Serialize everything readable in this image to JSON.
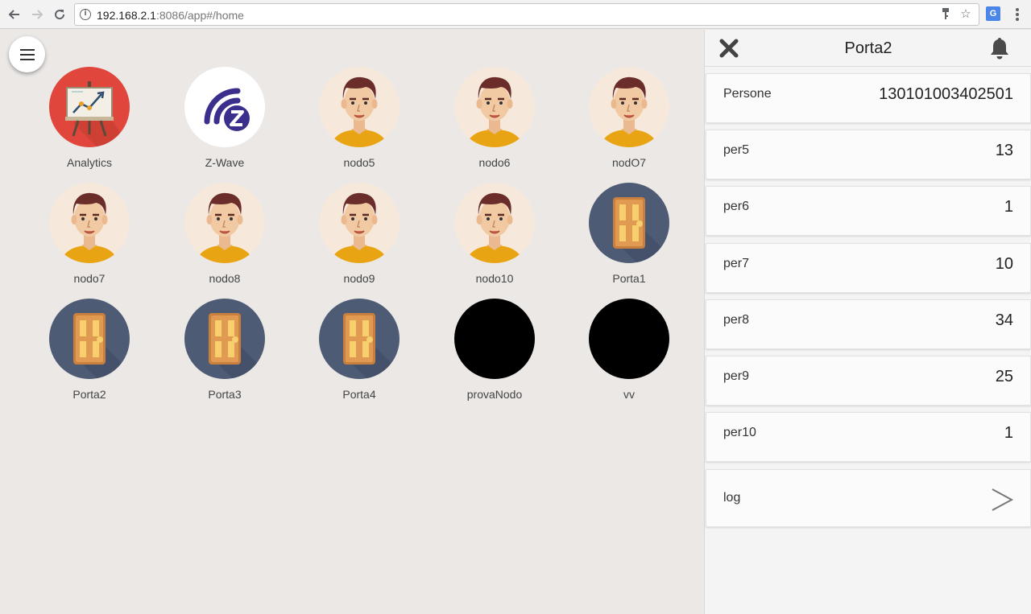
{
  "browser": {
    "url_host": "192.168.2.1",
    "url_rest": ":8086/app#/home"
  },
  "grid": {
    "tiles": [
      {
        "label": "Analytics",
        "icon": "analytics-icon"
      },
      {
        "label": "Z-Wave",
        "icon": "zwave-icon"
      },
      {
        "label": "nodo5",
        "icon": "person-avatar-icon"
      },
      {
        "label": "nodo6",
        "icon": "person-avatar-icon"
      },
      {
        "label": "nodO7",
        "icon": "person-avatar-icon"
      },
      {
        "label": "nodo7",
        "icon": "person-avatar-icon"
      },
      {
        "label": "nodo8",
        "icon": "person-avatar-icon"
      },
      {
        "label": "nodo9",
        "icon": "person-avatar-icon"
      },
      {
        "label": "nodo10",
        "icon": "person-avatar-icon"
      },
      {
        "label": "Porta1",
        "icon": "door-icon"
      },
      {
        "label": "Porta2",
        "icon": "door-icon"
      },
      {
        "label": "Porta3",
        "icon": "door-icon"
      },
      {
        "label": "Porta4",
        "icon": "door-icon"
      },
      {
        "label": "provaNodo",
        "icon": "black-circle-icon"
      },
      {
        "label": "vv",
        "icon": "black-circle-icon"
      }
    ]
  },
  "panel": {
    "title": "Porta2",
    "rows": [
      {
        "label": "Persone",
        "value": "130101003402501"
      },
      {
        "label": "per5",
        "value": "13"
      },
      {
        "label": "per6",
        "value": "1"
      },
      {
        "label": "per7",
        "value": "10"
      },
      {
        "label": "per8",
        "value": "34"
      },
      {
        "label": "per9",
        "value": "25"
      },
      {
        "label": "per10",
        "value": "1"
      }
    ],
    "log_label": "log"
  },
  "colors": {
    "background": "#ebe8e6",
    "analytics_red": "#e0463b",
    "door_circle": "#4e5b74",
    "door": "#e09a52",
    "zwave_blue": "#3a2f8c",
    "person_bg": "#f6e9dc",
    "shirt": "#e8a412"
  }
}
